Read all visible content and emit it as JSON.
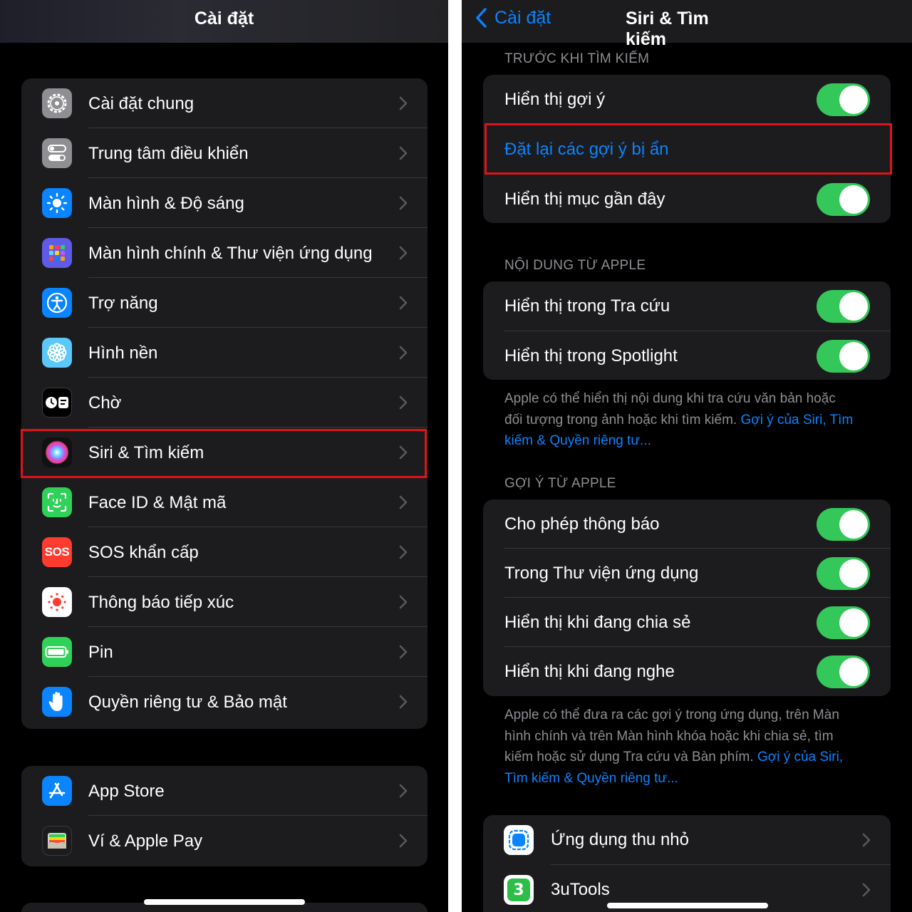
{
  "left": {
    "title": "Cài đặt",
    "group1": [
      {
        "label": "Cài đặt chung",
        "icon": "gear-icon",
        "color": "#8e8e93"
      },
      {
        "label": "Trung tâm điều khiển",
        "icon": "toggles-icon",
        "color": "#8e8e93"
      },
      {
        "label": "Màn hình & Độ sáng",
        "icon": "sun-icon",
        "color": "#0a84ff"
      },
      {
        "label": "Màn hình chính & Thư viện ứng dụng",
        "icon": "app-grid-icon",
        "color": "#5e5ce6"
      },
      {
        "label": "Trợ năng",
        "icon": "accessibility-icon",
        "color": "#0a84ff"
      },
      {
        "label": "Hình nền",
        "icon": "flower-icon",
        "color": "#5ac8fa"
      },
      {
        "label": "Chờ",
        "icon": "standby-icon",
        "color": "#000000"
      },
      {
        "label": "Siri & Tìm kiếm",
        "icon": "siri-icon",
        "color": "#1c1c1e"
      },
      {
        "label": "Face ID & Mật mã",
        "icon": "face-id-icon",
        "color": "#30d158"
      },
      {
        "label": "SOS khẩn cấp",
        "icon": "sos-icon",
        "color": "#ff3b30",
        "icon_text": "SOS"
      },
      {
        "label": "Thông báo tiếp xúc",
        "icon": "exposure-icon",
        "color": "#ffffff"
      },
      {
        "label": "Pin",
        "icon": "battery-icon",
        "color": "#30d158"
      },
      {
        "label": "Quyền riêng tư & Bảo mật",
        "icon": "hand-icon",
        "color": "#0a84ff"
      }
    ],
    "group2": [
      {
        "label": "App Store",
        "icon": "app-store-icon",
        "color": "#0a84ff"
      },
      {
        "label": "Ví & Apple Pay",
        "icon": "wallet-icon",
        "color": "#1c1c1e"
      }
    ]
  },
  "right": {
    "back_label": "Cài đặt",
    "title": "Siri & Tìm kiếm",
    "section1": {
      "header": "TRƯỚC KHI TÌM KIẾM",
      "rows": [
        {
          "label": "Hiển thị gợi ý",
          "on": true
        },
        {
          "label": "Đặt lại các gợi ý bị ẩn"
        },
        {
          "label": "Hiển thị mục gần đây",
          "on": true
        }
      ]
    },
    "section2": {
      "header": "NỘI DUNG TỪ APPLE",
      "rows": [
        {
          "label": "Hiển thị trong Tra cứu",
          "on": true
        },
        {
          "label": "Hiển thị trong Spotlight",
          "on": true
        }
      ],
      "footer_line1": "Apple có thể hiển thị nội dung khi tra cứu văn bản hoặc",
      "footer_line2": "đối tượng trong ảnh hoặc khi tìm kiếm.",
      "footer_link_a": "Gợi ý của Siri, Tìm",
      "footer_link_b": "kiếm & Quyền riêng tư..."
    },
    "section3": {
      "header": "GỢI Ý TỪ APPLE",
      "rows": [
        {
          "label": "Cho phép thông báo",
          "on": true
        },
        {
          "label": "Trong Thư viện ứng dụng",
          "on": true
        },
        {
          "label": "Hiển thị khi đang chia sẻ",
          "on": true
        },
        {
          "label": "Hiển thị khi đang nghe",
          "on": true
        }
      ],
      "footer_line1": "Apple có thể đưa ra các gợi ý trong ứng dụng, trên Màn",
      "footer_line2": "hình chính và trên Màn hình khóa hoặc khi chia sẻ, tìm",
      "footer_line3": "kiếm hoặc sử dụng Tra cứu và Bàn phím.",
      "footer_link_a": "Gợi ý của Siri,",
      "footer_link_b": "Tìm kiếm & Quyền riêng tư..."
    },
    "apps": [
      {
        "label": "Ứng dụng thu nhỏ",
        "icon": "app-clip-icon",
        "color": "#ffffff"
      },
      {
        "label": "3uTools",
        "icon": "3utools-icon",
        "color": "#ffffff",
        "icon_text": "3"
      }
    ]
  },
  "colors": {
    "accent": "#0a84ff",
    "toggle_on": "#34c759",
    "highlight_box": "#e0121b",
    "background": "#000000",
    "cell": "#1c1c1e"
  }
}
